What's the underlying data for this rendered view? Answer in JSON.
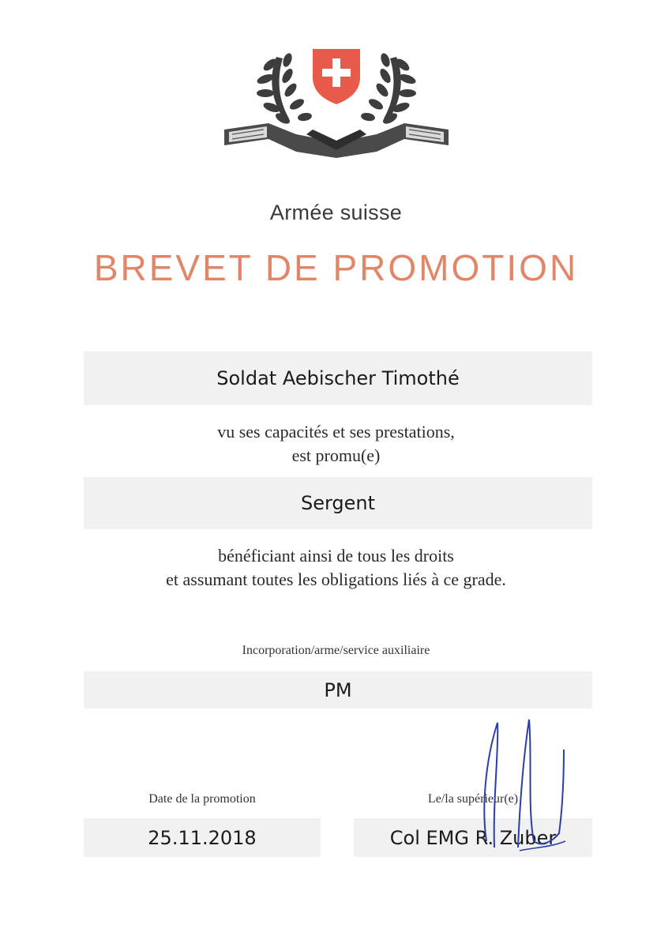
{
  "header": {
    "emblem": "swiss-coat-of-arms-laurel-icon",
    "army": "Armée suisse",
    "title": "BREVET DE PROMOTION"
  },
  "recipient": {
    "name": "Soldat Aebischer Timothé"
  },
  "text": {
    "line1": "vu ses capacités et ses prestations,",
    "line2": "est promu(e)",
    "line3": "bénéficiant ainsi de tous les droits",
    "line4": "et assumant toutes les obligations liés à ce grade."
  },
  "rank": "Sergent",
  "incorporation": {
    "label": "Incorporation/arme/service auxiliaire",
    "value": "PM"
  },
  "footer": {
    "date_label": "Date de la promotion",
    "date_value": "25.11.2018",
    "superior_label": "Le/la supérieur(e)",
    "superior_value": "Col EMG R. Zuber"
  },
  "colors": {
    "title": "#e0876a",
    "shield": "#e85a4a",
    "band": "#f1f1f1",
    "signature_ink": "#2a3fa8"
  }
}
